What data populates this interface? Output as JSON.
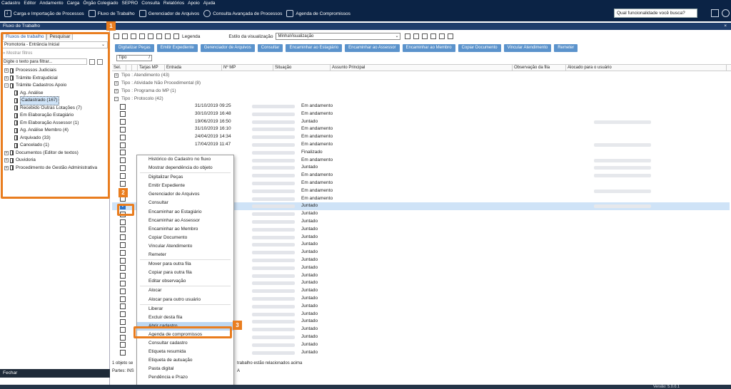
{
  "menu": [
    "Cadastro",
    "Editor",
    "Andamento",
    "Carga",
    "Órgão Colegiado",
    "SEPRO",
    "Consulta",
    "Relatórios",
    "Apoio",
    "Ajuda"
  ],
  "toolbar": {
    "items": [
      "Carga e Importação de Processos",
      "Fluxo de Trabalho",
      "Gerenciador de Arquivos",
      "Consulta Avançada de Processos",
      "Agenda de Compromissos"
    ],
    "search_placeholder": "Qual funcionalidade você busca?"
  },
  "window": {
    "title": "Fluxo de Trabalho",
    "close": "×"
  },
  "left": {
    "tabs": [
      "Fluxos de trabalho",
      "Pesquisar"
    ],
    "selected_flow": "Promotoria - Entrância Inicial",
    "show_filters": "Mostrar filtros",
    "search_placeholder": "Digite o texto para filtrar...",
    "tree": [
      {
        "label": "Processos Judiciais",
        "level": 0,
        "exp": "+"
      },
      {
        "label": "Trâmite Extrajudicial",
        "level": 0,
        "exp": "+"
      },
      {
        "label": "Trâmite Cadastros Apoio",
        "level": 0,
        "exp": "−"
      },
      {
        "label": "Ag. Análise",
        "level": 1
      },
      {
        "label": "Cadastrado (167)",
        "level": 1,
        "selected": true
      },
      {
        "label": "Recebido Outras Lotações (7)",
        "level": 1
      },
      {
        "label": "Em Elaboração Estagiário",
        "level": 1
      },
      {
        "label": "Em Elaboração Assessor (1)",
        "level": 1
      },
      {
        "label": "Ag. Análise Membro (4)",
        "level": 1
      },
      {
        "label": "Arquivado (33)",
        "level": 1
      },
      {
        "label": "Cancelado (1)",
        "level": 1
      },
      {
        "label": "Documentos (Editor de textos)",
        "level": 0,
        "exp": "+"
      },
      {
        "label": "Ouvidoria",
        "level": 0,
        "exp": "+"
      },
      {
        "label": "Procedimento de Gestão Administrativa",
        "level": 0,
        "exp": "+"
      }
    ],
    "footer": "Fechar"
  },
  "right": {
    "legend": "Legenda",
    "view_label": "Estilo da visualização",
    "view_value": "MinhaVisualização",
    "actions": [
      "Digitalizar Peças",
      "Emitir Expediente",
      "Gerenciador de Arquivos",
      "Consultar",
      "Encaminhar ao Estagiário",
      "Encaminhar ao Assessor",
      "Encaminhar ao Membro",
      "Copiar Documento",
      "Vincular Atendimento",
      "Remeter"
    ],
    "group_chip": "Tipo",
    "columns": [
      "Sel.",
      "",
      "",
      "Tarjas MP",
      "Entrada",
      "Nº MP",
      "Situação",
      "Assunto Principal",
      "Observação da fila",
      "Alocado para o usuário"
    ],
    "groups": [
      "Tipo : Atendimento  (43)",
      "Tipo : Atividade Não Procedimental  (8)",
      "Tipo : Programa do MP  (1)",
      "Tipo : Protocolo  (42)"
    ],
    "rows": [
      {
        "date": "31/10/2019 09:25",
        "status": "Em andamento"
      },
      {
        "date": "30/10/2019 16:48",
        "status": "Em andamento"
      },
      {
        "date": "19/06/2019 16:50",
        "status": "Juntado"
      },
      {
        "date": "31/10/2019 16:10",
        "status": "Em andamento"
      },
      {
        "date": "24/04/2019 14:34",
        "status": "Em andamento"
      },
      {
        "date": "17/04/2019 11:47",
        "status": "Em andamento"
      },
      {
        "date": "",
        "status": "Finalizado"
      },
      {
        "date": "",
        "status": "Em andamento"
      },
      {
        "date": "",
        "status": "Juntado"
      },
      {
        "date": "",
        "status": "Em andamento"
      },
      {
        "date": "",
        "status": "Em andamento"
      },
      {
        "date": "",
        "status": "Em andamento"
      },
      {
        "date": "",
        "status": "Em andamento"
      },
      {
        "date": "",
        "status": "Juntado"
      },
      {
        "date": "",
        "status": "Juntado"
      },
      {
        "date": "",
        "status": "Juntado"
      },
      {
        "date": "",
        "status": "Juntado"
      },
      {
        "date": "",
        "status": "Juntado"
      },
      {
        "date": "",
        "status": "Juntado"
      },
      {
        "date": "",
        "status": "Juntado"
      },
      {
        "date": "",
        "status": "Juntado"
      },
      {
        "date": "",
        "status": "Juntado"
      },
      {
        "date": "",
        "status": "Juntado"
      },
      {
        "date": "",
        "status": "Juntado"
      },
      {
        "date": "",
        "status": "Juntado"
      },
      {
        "date": "",
        "status": "Juntado"
      },
      {
        "date": "",
        "status": "Juntado"
      },
      {
        "date": "",
        "status": "Juntado"
      },
      {
        "date": "",
        "status": "Juntado"
      },
      {
        "date": "",
        "status": "Juntado"
      },
      {
        "date": "",
        "status": "Juntado"
      },
      {
        "date": "",
        "status": "Juntado"
      },
      {
        "date": "",
        "status": "Juntado"
      }
    ],
    "status1_a": "1 objeto se",
    "status1_b": "trabalho estão relacionados acima",
    "status2_a": "Partes: INS",
    "status2_b": "A"
  },
  "context_menu": [
    [
      "Histórico do Cadastro no fluxo",
      "Mostrar dependência do objeto"
    ],
    [
      "Digitalizar Peças",
      "Emitir Expediente",
      "Gerenciador de Arquivos",
      "Consultar",
      "Encaminhar ao Estagiário",
      "Encaminhar ao Assessor",
      "Encaminhar ao Membro",
      "Copiar Documento",
      "Vincular Atendimento",
      "Remeter"
    ],
    [
      "Mover para outra fila",
      "Copiar para outra fila",
      "Editar observação"
    ],
    [
      "Alocar",
      "Alocar para outro usuário"
    ],
    [
      "Liberar",
      "Excluir desta fila",
      "Abrir cadastro",
      "Agenda de compromissos",
      "Consultar cadastro",
      "Etiqueta resumida",
      "Etiqueta de autuação",
      "Pasta digital",
      "Pendência e Prazo"
    ]
  ],
  "context_highlight": "Abrir cadastro",
  "callouts": [
    "1",
    "2",
    "3"
  ],
  "version": "Versão: 5.0.0.1",
  "colors": {
    "accent": "#e97d1f",
    "header": "#0b2345",
    "button": "#5b93cc",
    "selection": "#cfe3f7"
  }
}
